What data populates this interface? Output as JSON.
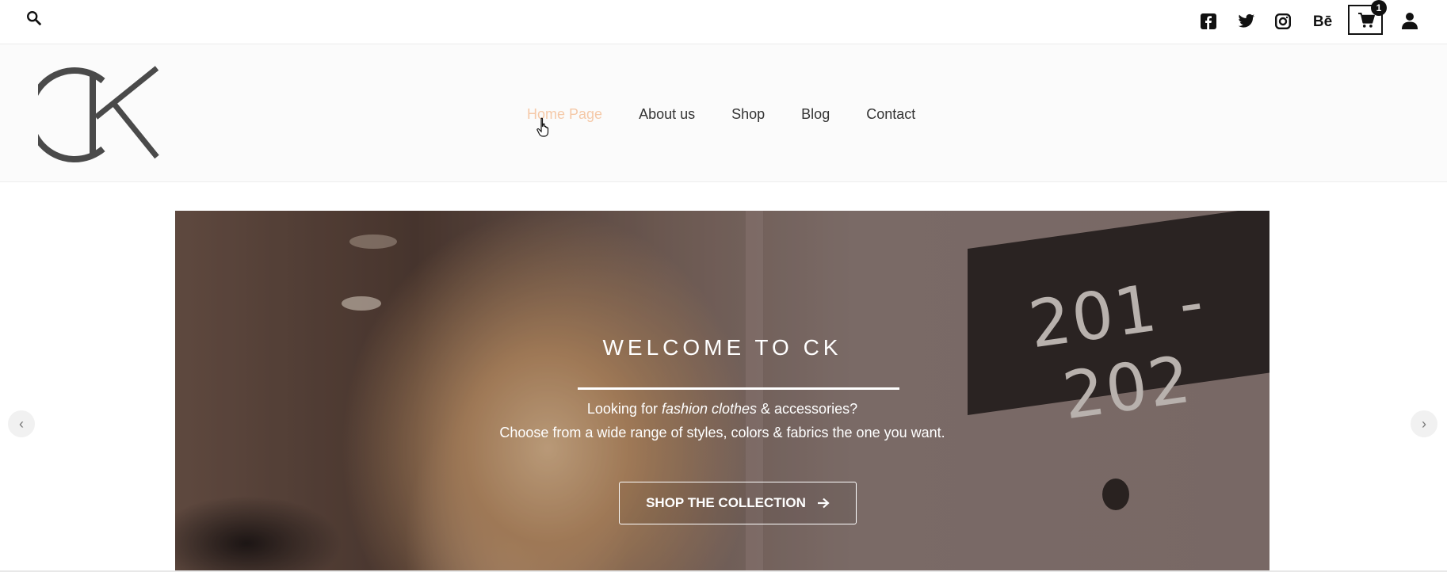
{
  "topbar": {
    "search_icon": "search-icon",
    "social": [
      "facebook-icon",
      "twitter-icon",
      "instagram-icon",
      "behance-icon"
    ],
    "behance_label": "Bē",
    "cart_count": "1",
    "cart_icon": "cart-icon",
    "user_icon": "user-icon"
  },
  "header": {
    "logo_text": "CK",
    "nav": [
      "Home Page",
      "About us",
      "Shop",
      "Blog",
      "Contact"
    ],
    "active_nav": "Home Page",
    "active_color": "#f5c9a8"
  },
  "hero": {
    "plaque_text": "201 - 202",
    "title": "WELCOME TO CK",
    "line1_prefix": "Looking for ",
    "line1_emph": "fashion clothes",
    "line1_suffix": " & accessories?",
    "line2": "Choose from a wide range of styles, colors & fabrics the one you want.",
    "cta_label": "SHOP THE COLLECTION",
    "prev_glyph": "‹",
    "next_glyph": "›"
  }
}
